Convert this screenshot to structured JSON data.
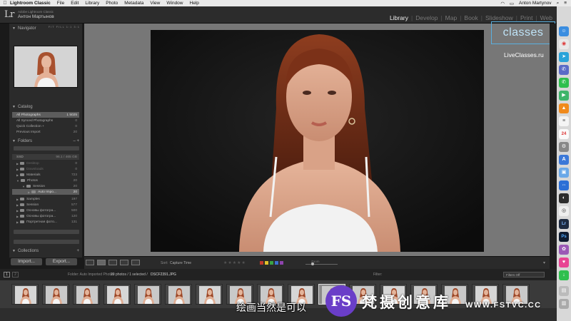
{
  "menubar": {
    "app": "Lightroom Classic",
    "items": [
      "File",
      "Edit",
      "Library",
      "Photo",
      "Metadata",
      "View",
      "Window",
      "Help"
    ],
    "user": "Anton Martynov"
  },
  "header": {
    "logo": "Lr",
    "identity_small": "Adobe Lightroom Classic",
    "identity_name": "Антон Мартынов",
    "modules": [
      "Library",
      "Develop",
      "Map",
      "Book",
      "Slideshow",
      "Print",
      "Web"
    ],
    "active_module": "Library"
  },
  "overlay": {
    "badge": "classes",
    "site": "LiveClasses.ru"
  },
  "navigator": {
    "title": "Navigator",
    "options": "FIT  FILL  1:1  3:1"
  },
  "catalog": {
    "title": "Catalog",
    "items": [
      {
        "label": "All Photographs",
        "count": "1 5025",
        "selected": true
      },
      {
        "label": "All Synced Photographs",
        "count": "0"
      },
      {
        "label": "Quick Collection +",
        "count": "0"
      },
      {
        "label": "Previous Import",
        "count": "20"
      }
    ]
  },
  "folders": {
    "title": "Folders",
    "volume": {
      "label": "SSD",
      "info": "96.1 / 465 GB"
    },
    "items": [
      {
        "label": "Desktop",
        "count": "0",
        "indent": 0,
        "dim": true
      },
      {
        "label": "Downloads",
        "count": "0",
        "indent": 0,
        "dim": true
      },
      {
        "label": "Materials",
        "count": "723",
        "indent": 0
      },
      {
        "label": "Photos",
        "count": "20",
        "indent": 0
      },
      {
        "label": "Session",
        "count": "20",
        "indent": 1
      },
      {
        "label": "Auto Impo...",
        "count": "20",
        "indent": 2,
        "selected": true
      },
      {
        "label": "Samples",
        "count": "197",
        "indent": 0
      },
      {
        "label": "Session",
        "count": "577",
        "indent": 0
      },
      {
        "label": "Основы фотогра...",
        "count": "500",
        "indent": 0
      },
      {
        "label": "Основы фотогра...",
        "count": "120",
        "indent": 0
      },
      {
        "label": "Портретная фото...",
        "count": "131",
        "indent": 0
      }
    ]
  },
  "collections": {
    "title": "Collections"
  },
  "buttons": {
    "import": "Import...",
    "export": "Export..."
  },
  "toolbar": {
    "sort_label": "Sort:",
    "sort_value": "Capture Time",
    "zoom_label": "Zoom"
  },
  "filmstrip": {
    "page1": "1",
    "page2": "2",
    "source": "Folder: Auto Imported Photos",
    "count": "20 photos / 1 selected /",
    "file": "DSCF2391.JPG",
    "filter_label": "Filter:",
    "filter_value": "Filters Off",
    "thumb_count": 20,
    "selected_index": 10
  },
  "subtitle": "绘画当然是可以",
  "watermark": {
    "logo": "FS",
    "text": "梵摄创意库",
    "url": "WWW.FSTVC.CC"
  },
  "colors": {
    "accent": "#e6e6e6",
    "panel": "#2b2b2b",
    "workspace": "#777777",
    "badge": "#5ab0e0"
  }
}
